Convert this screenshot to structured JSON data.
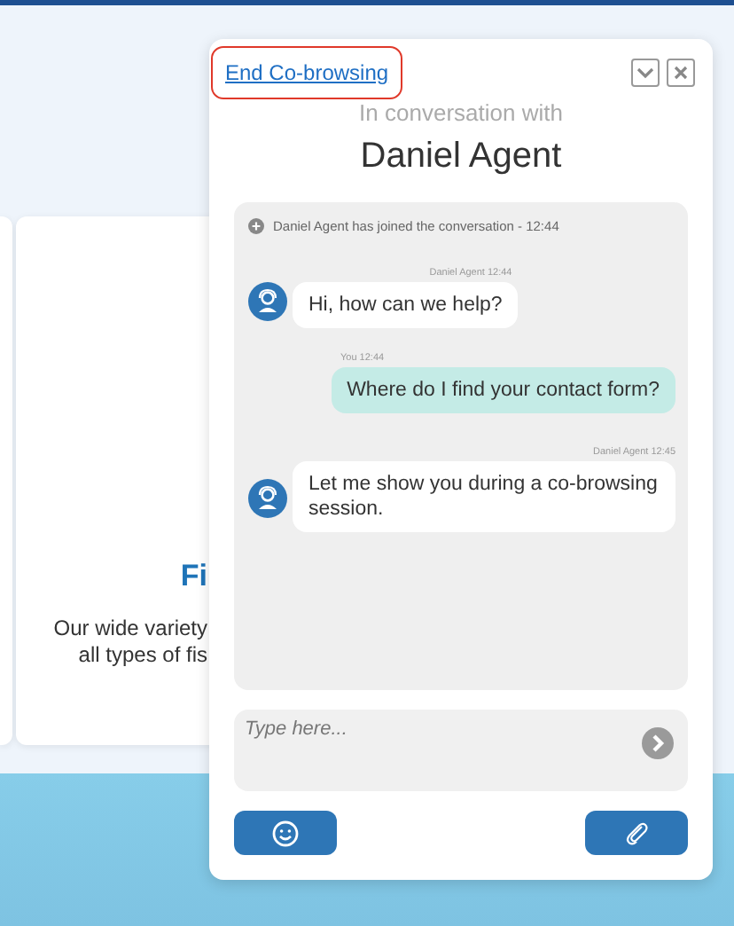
{
  "background_card": {
    "title": "Fi",
    "lines": [
      "Our wide variety",
      "all types of fis"
    ]
  },
  "chat": {
    "end_link": "End Co-browsing",
    "subtitle": "In conversation with",
    "agent_name": "Daniel Agent",
    "messages": [
      {
        "kind": "system",
        "text": "Daniel Agent has joined the conversation - 12:44"
      },
      {
        "kind": "agent",
        "meta": "Daniel Agent  12:44",
        "text": "Hi, how can we help?"
      },
      {
        "kind": "user",
        "meta": "You  12:44",
        "text": "Where do I find your contact form?"
      },
      {
        "kind": "agent",
        "meta": "Daniel Agent  12:45",
        "text": "Let me show you during a co-browsing session."
      }
    ],
    "input": {
      "placeholder": "Type here..."
    }
  }
}
